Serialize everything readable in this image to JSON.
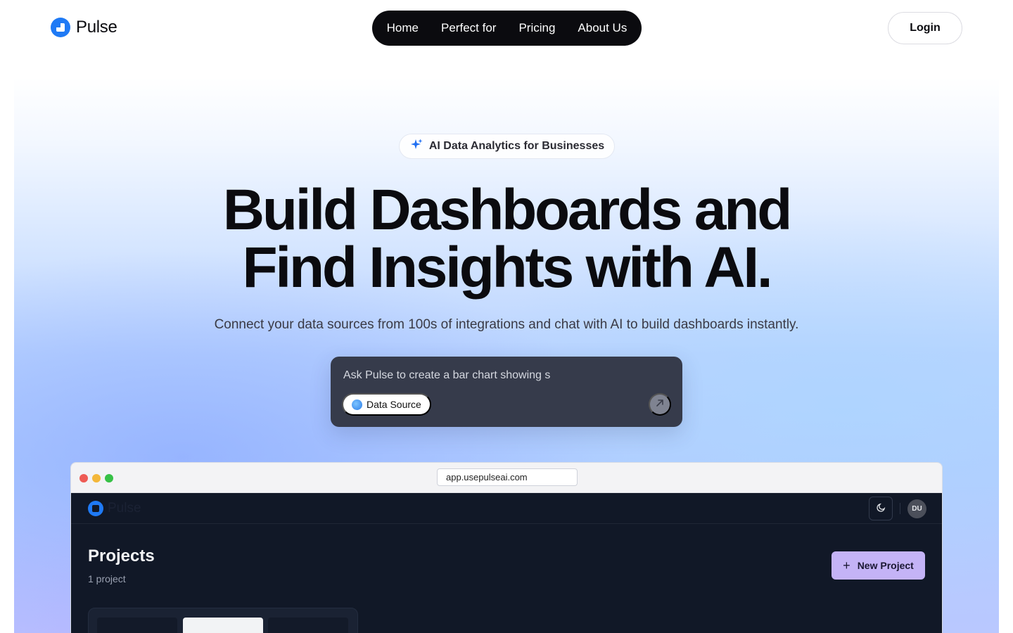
{
  "nav": {
    "brand": "Pulse",
    "links": [
      "Home",
      "Perfect for",
      "Pricing",
      "About Us"
    ],
    "login_label": "Login"
  },
  "hero": {
    "badge_icon": "sparkle-icon",
    "badge_text": "AI Data Analytics for Businesses",
    "headline_line1": "Build Dashboards and",
    "headline_line2": "Find Insights with AI.",
    "subhead": "Connect your data sources from 100s of integrations and chat with AI to build dashboards instantly.",
    "prompt": {
      "value": "Ask Pulse to create a bar chart showing s",
      "data_source_label": "Data Source",
      "send_icon": "arrow-up-right-icon"
    }
  },
  "browser": {
    "url": "app.usepulseai.com",
    "app": {
      "brand": "Pulse",
      "avatar_initials": "DU",
      "theme_icon": "moon-icon",
      "projects_title": "Projects",
      "projects_count": "1 project",
      "new_project_label": "New Project"
    }
  },
  "colors": {
    "accent_blue": "#1f7af5",
    "nav_bg": "#0b0b0f",
    "prompt_bg": "#363b4b",
    "app_bg": "#111827",
    "new_project_bg": "#c4b3f6"
  }
}
